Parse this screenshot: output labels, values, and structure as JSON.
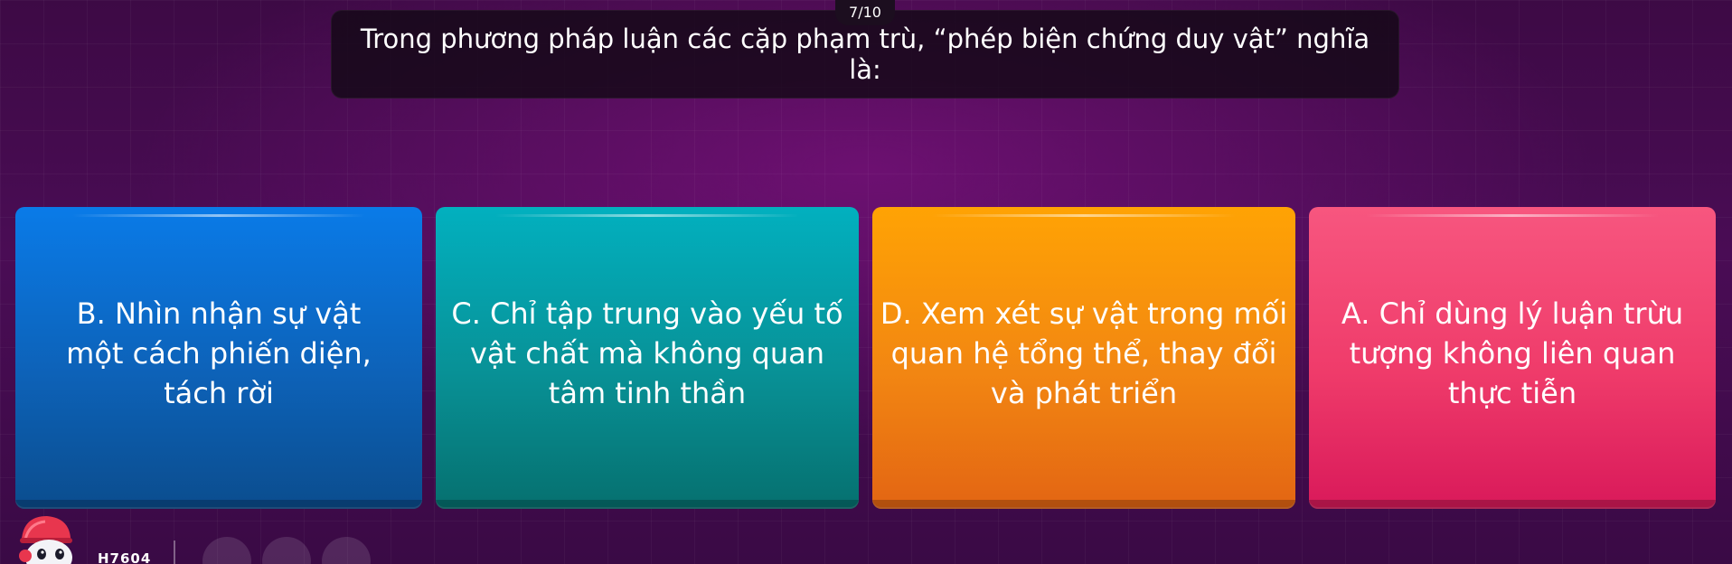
{
  "quiz": {
    "progress": "7/10",
    "question": "Trong phương pháp luận các cặp phạm trù, “phép biện chứng duy vật” nghĩa là:"
  },
  "options": [
    {
      "text": "B. Nhìn nhận sự vật một cách phiến diện, tách rời",
      "color": "#0d62b8"
    },
    {
      "text": "C. Chỉ tập trung vào yếu tố vật chất mà không quan tâm tinh thần",
      "color": "#089196"
    },
    {
      "text": "D. Xem xét sự vật trong mối quan hệ tổng thể, thay đổi và phát triển",
      "color": "#f28612"
    },
    {
      "text": "A. Chỉ dùng lý luận trừu tượng không liên quan thực tiễn",
      "color": "#ef3b6a"
    }
  ],
  "player": {
    "name": "H7604",
    "avatar_icon": "avatar-robot-icon"
  },
  "powerups": [
    {
      "icon": "powerup-slot-icon"
    },
    {
      "icon": "powerup-slot-icon"
    },
    {
      "icon": "powerup-slot-icon"
    }
  ]
}
